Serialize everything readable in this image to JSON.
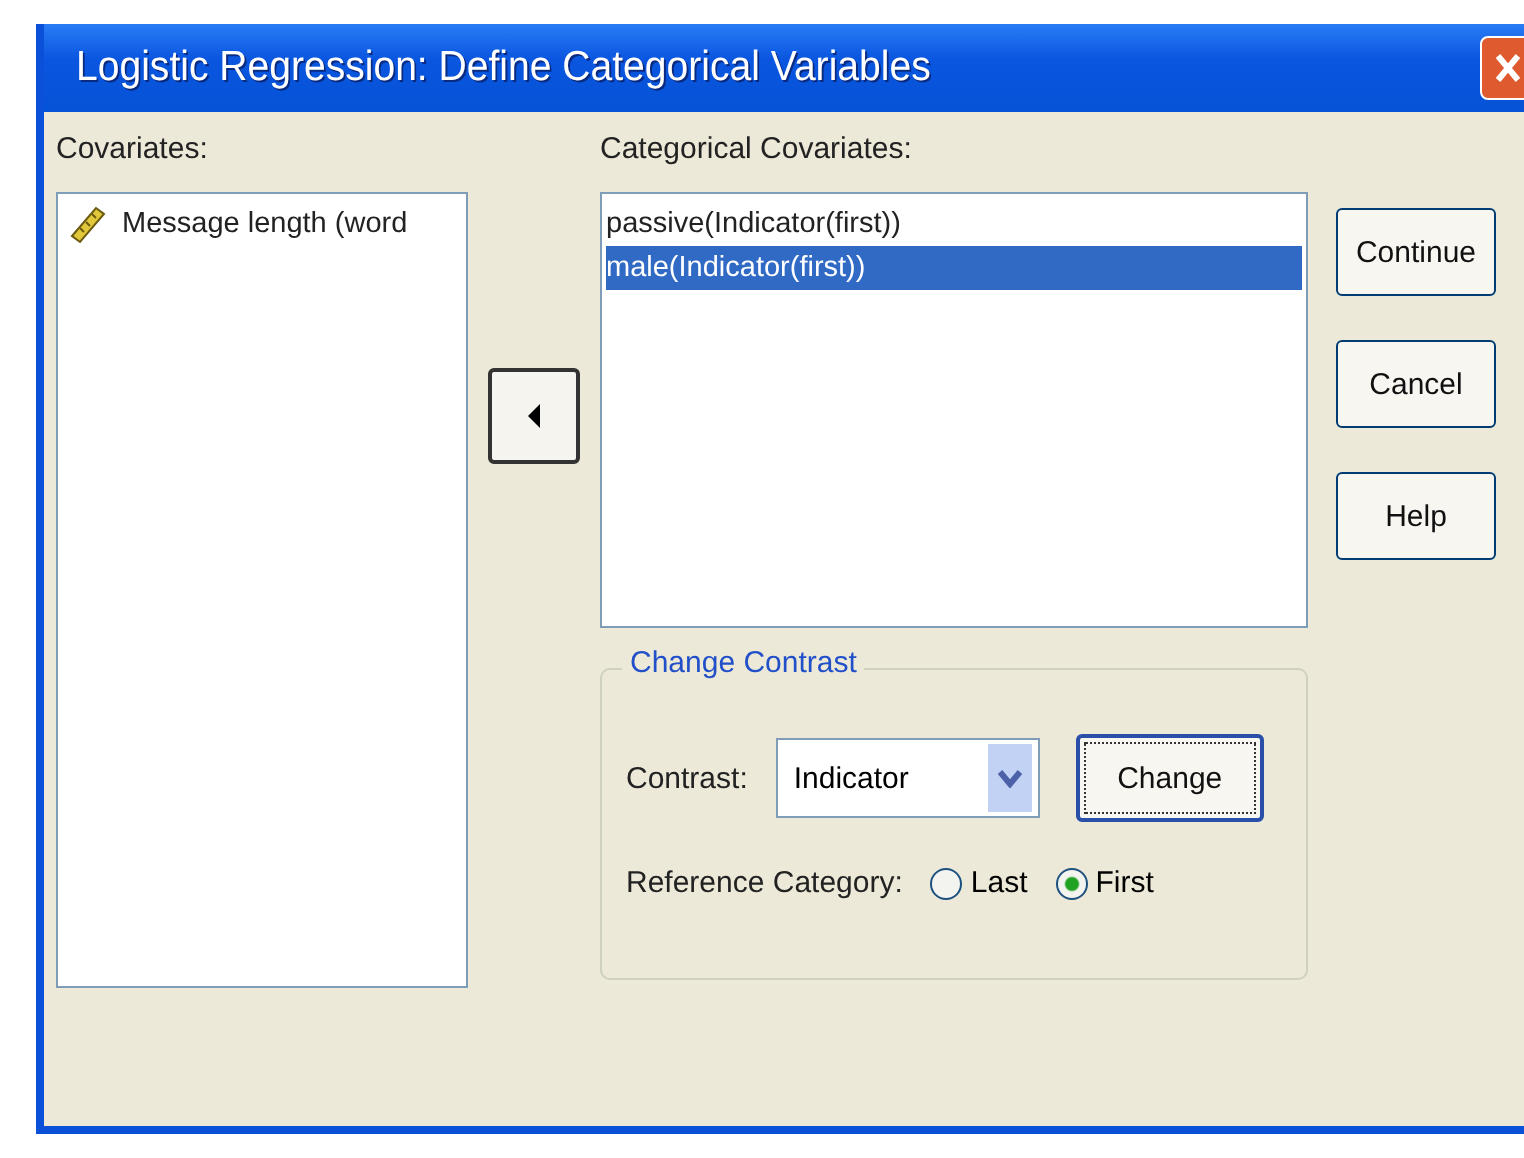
{
  "window": {
    "title": "Logistic Regression: Define Categorical Variables"
  },
  "covariates": {
    "label": "Covariates:",
    "items": [
      {
        "label": "Message length (word",
        "selected": false
      }
    ]
  },
  "categorical_covariates": {
    "label": "Categorical Covariates:",
    "items": [
      {
        "label": "passive(Indicator(first))",
        "selected": false
      },
      {
        "label": "male(Indicator(first))",
        "selected": true
      }
    ]
  },
  "change_contrast": {
    "title": "Change Contrast",
    "contrast_label": "Contrast:",
    "contrast_value": "Indicator",
    "change_button": "Change",
    "reference_label": "Reference Category:",
    "reference_options": [
      {
        "label": "Last",
        "selected": false
      },
      {
        "label": "First",
        "selected": true
      }
    ]
  },
  "buttons": [
    "Continue",
    "Cancel",
    "Help"
  ]
}
